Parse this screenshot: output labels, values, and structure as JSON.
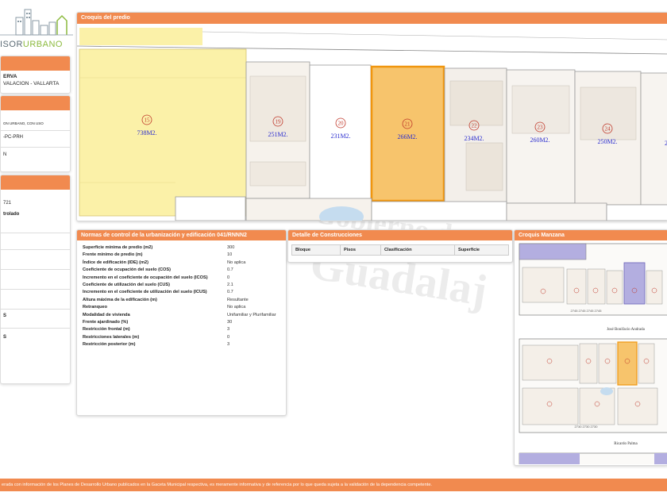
{
  "app": {
    "logo_text_a": "ISOR",
    "logo_text_b": "URBANO",
    "watermark_a": "Gobierno de",
    "watermark_b": "Guadalaj"
  },
  "sidebar": {
    "card1_lines": [
      "ERVA",
      "VALACION - VALLARTA"
    ],
    "card2_lines": [
      "ON URBANO, CON USO",
      "-PC-PRH",
      "N"
    ],
    "card3_lines": [
      "721",
      "trolado",
      "",
      "",
      "",
      "",
      "S",
      "S"
    ]
  },
  "croquis_predio": {
    "title": "Croquis del predio",
    "lots": [
      {
        "num": "15",
        "area": "738M2."
      },
      {
        "num": "19",
        "area": "251M2."
      },
      {
        "num": "20",
        "area": "231M2."
      },
      {
        "num": "21",
        "area": "266M2."
      },
      {
        "num": "22",
        "area": "234M2."
      },
      {
        "num": "23",
        "area": "260M2."
      },
      {
        "num": "24",
        "area": "250M2."
      },
      {
        "num": "",
        "area": "26"
      }
    ]
  },
  "normas": {
    "title": "Normas de control de la urbanización y edificación 041/RNNN2",
    "rows": [
      {
        "label": "Superficie mínima de predio (m2)",
        "value": "300"
      },
      {
        "label": "Frente mínimo de predio (m)",
        "value": "10"
      },
      {
        "label": "Índice de edificación (IDE) (m2)",
        "value": "No aplica"
      },
      {
        "label": "Coeficiente de ocupación del suelo (COS)",
        "value": "0.7"
      },
      {
        "label": "Incremento en el coeficiente de ocupación del suelo (ICOS)",
        "value": "0"
      },
      {
        "label": "Coeficiente de utilización del suelo (CUS)",
        "value": "2.1"
      },
      {
        "label": "Incremento en el coeficiente de utilización del suelo (ICUS)",
        "value": "0.7"
      },
      {
        "label": "Altura máxima de la edificación (m)",
        "value": "Resultante"
      },
      {
        "label": "Retranqueo",
        "value": "No aplica"
      },
      {
        "label": "Modalidad de vivienda",
        "value": "Unifamiliar y Plurifamiliar"
      },
      {
        "label": "Frente ajardinado (%)",
        "value": "30"
      },
      {
        "label": "Restricción frontal (m)",
        "value": "3"
      },
      {
        "label": "Restricciones laterales (m)",
        "value": "0"
      },
      {
        "label": "Restricción posterior (m)",
        "value": "3"
      }
    ]
  },
  "construcciones": {
    "title": "Detalle de Construcciones",
    "columns": [
      "Bloque",
      "Pisos",
      "Clasificación",
      "Superficie"
    ]
  },
  "manzana": {
    "title": "Croquis Manzana",
    "street1": "José Bonifacio Andrada",
    "street2": "Ricardo Palma"
  },
  "footer": {
    "text": "erada con información de los Planes de Desarrollo Urbano publicados en la Gaceta Municipal respectiva, es meramente informativa y de referencia por lo que queda sujeta a la validación de la dependencia competente."
  },
  "colors": {
    "accent": "#f18a4f",
    "selected_lot": "#f7c46c",
    "selected_lot_border": "#f0960f",
    "yellow_lot": "#fbf1a8",
    "purple_lot": "#b3aee0",
    "lot_number": "#c0392b",
    "lot_area": "#2d2fcf"
  }
}
